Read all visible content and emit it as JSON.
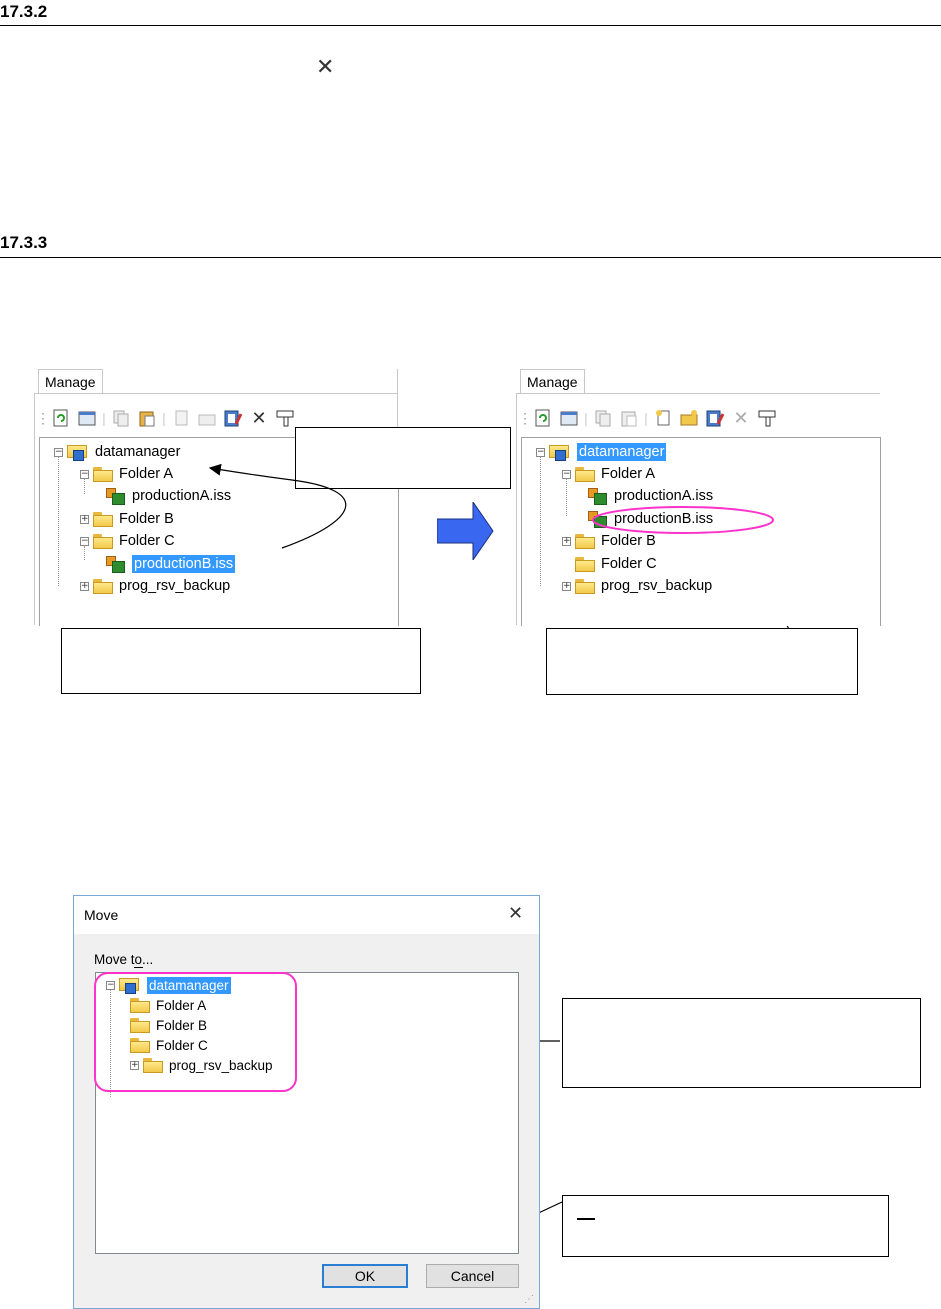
{
  "section1": {
    "number": "17.3.2"
  },
  "section2": {
    "number": "17.3.3"
  },
  "left_panel": {
    "tab": "Manage",
    "tree": {
      "root": "datamanager",
      "folder_a": "Folder A",
      "file_a": "productionA.iss",
      "folder_b": "Folder B",
      "folder_c": "Folder C",
      "file_b": "productionB.iss",
      "backup": "prog_rsv_backup"
    }
  },
  "right_panel": {
    "tab": "Manage",
    "tree": {
      "root": "datamanager",
      "folder_a": "Folder A",
      "file_a": "productionA.iss",
      "file_b": "productionB.iss",
      "folder_b": "Folder B",
      "folder_c": "Folder C",
      "backup": "prog_rsv_backup"
    }
  },
  "dialog": {
    "title": "Move",
    "close_glyph": "✕",
    "label": "Move to...",
    "label_accel": "t",
    "tree": {
      "root": "datamanager",
      "folder_a": "Folder A",
      "folder_b": "Folder B",
      "folder_c": "Folder C",
      "backup": "prog_rsv_backup"
    },
    "ok": "OK",
    "cancel": "Cancel"
  },
  "glyphs": {
    "delete": "✕",
    "arrow_color": "#3a67f0",
    "highlight_color": "#ff33cc"
  }
}
